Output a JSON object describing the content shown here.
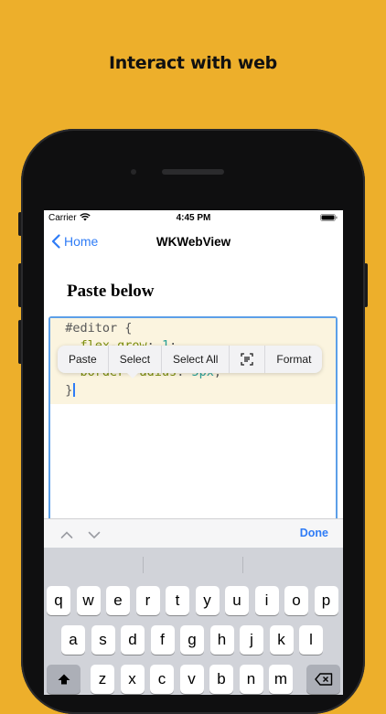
{
  "headline": "Interact with web",
  "status_bar": {
    "carrier": "Carrier",
    "time": "4:45 PM"
  },
  "nav": {
    "back_label": "Home",
    "title": "WKWebView"
  },
  "page": {
    "heading": "Paste below"
  },
  "editor": {
    "lines": [
      {
        "indent": "  ",
        "tokens": [
          {
            "text": "#editor {",
            "class": ""
          }
        ]
      },
      {
        "indent": "    ",
        "tokens": [
          {
            "text": "flex-grow",
            "class": "c-prop"
          },
          {
            "text": ": ",
            "class": ""
          },
          {
            "text": "1",
            "class": "c-num"
          },
          {
            "text": ";",
            "class": ""
          }
        ]
      },
      {
        "indent": "    ",
        "tokens": [
          {
            "text": "border-radius",
            "class": "c-prop"
          },
          {
            "text": ": ",
            "class": ""
          },
          {
            "text": "5px",
            "class": "c-num"
          },
          {
            "text": ";",
            "class": ""
          }
        ]
      },
      {
        "indent": "  ",
        "tokens": [
          {
            "text": "}",
            "class": ""
          }
        ]
      }
    ]
  },
  "context_menu": {
    "items": [
      {
        "label": "Paste",
        "icon": null
      },
      {
        "label": "Select",
        "icon": null
      },
      {
        "label": "Select All",
        "icon": null
      },
      {
        "label": "",
        "icon": "scan-text-icon"
      },
      {
        "label": "Format",
        "icon": null
      }
    ]
  },
  "accessory_bar": {
    "done_label": "Done"
  },
  "keyboard": {
    "row1": [
      "q",
      "w",
      "e",
      "r",
      "t",
      "y",
      "u",
      "i",
      "o",
      "p"
    ],
    "row2": [
      "a",
      "s",
      "d",
      "f",
      "g",
      "h",
      "j",
      "k",
      "l"
    ],
    "row3": [
      "z",
      "x",
      "c",
      "v",
      "b",
      "n",
      "m"
    ]
  },
  "colors": {
    "background": "#EDAF2B",
    "accent": "#2F7CF6"
  }
}
